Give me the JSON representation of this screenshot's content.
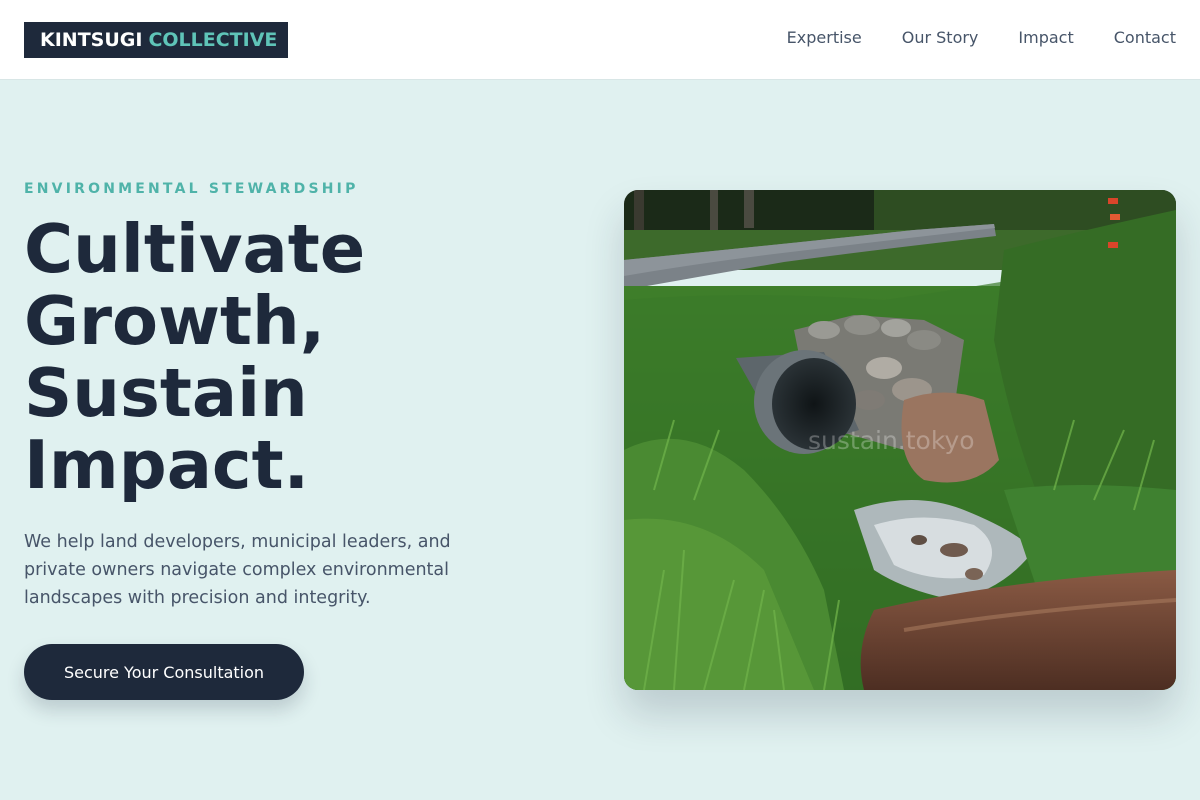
{
  "header": {
    "logo": {
      "part1": "KINTSUGI",
      "part2": "COLLECTIVE"
    },
    "nav": [
      "Expertise",
      "Our Story",
      "Impact",
      "Contact"
    ]
  },
  "hero": {
    "eyebrow": "ENVIRONMENTAL STEWARDSHIP",
    "headline": [
      "Cultivate",
      "Growth,",
      "Sustain",
      "Impact."
    ],
    "lede": "We help land developers, municipal leaders, and private owners navigate complex environmental landscapes with precision and integrity.",
    "cta_label": "Secure Your Consultation",
    "image": {
      "subject": "culvert-stream-grass-photo",
      "watermark": "sustain.tokyo"
    }
  },
  "colors": {
    "background": "#e0f1f0",
    "navy": "#1e293b",
    "teal_accent": "#5fc4b8",
    "body_text": "#475569"
  }
}
